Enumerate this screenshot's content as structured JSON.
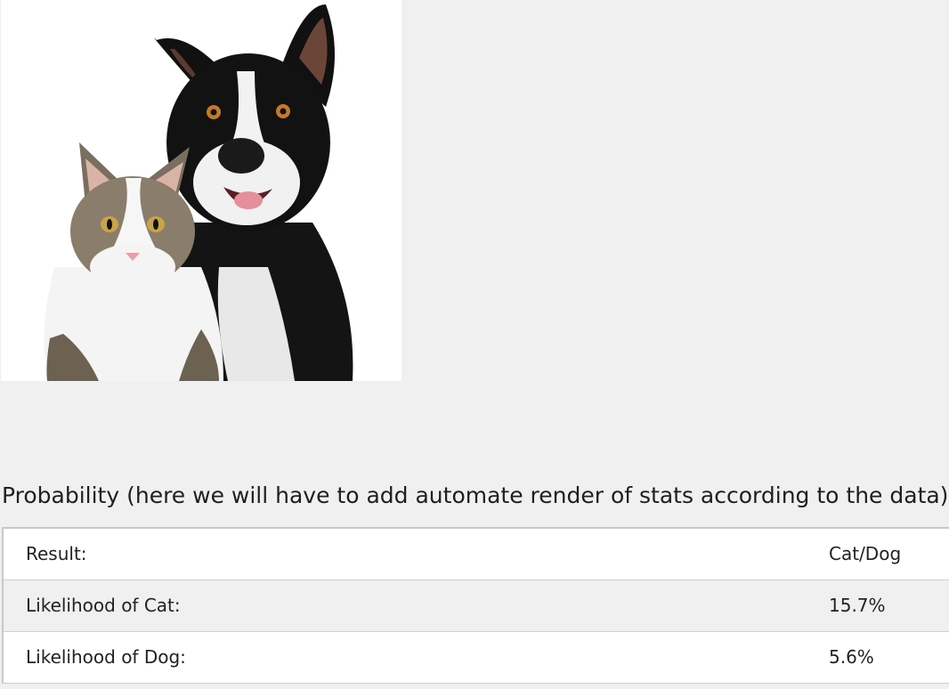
{
  "photo": {
    "subject": "cat-and-dog-photo"
  },
  "probability": {
    "heading": "Probability (here we will have to add automate render of stats according to the data)",
    "rows": [
      {
        "label": "Result:",
        "value": "Cat/Dog"
      },
      {
        "label": "Likelihood of Cat:",
        "value": "15.7%"
      },
      {
        "label": "Likelihood of Dog:",
        "value": "5.6%"
      }
    ]
  },
  "colors": {
    "page_background": "#f0f0f0",
    "row_odd": "#ffffff",
    "row_even": "#f0f0f0",
    "border": "#cfcfcf"
  }
}
